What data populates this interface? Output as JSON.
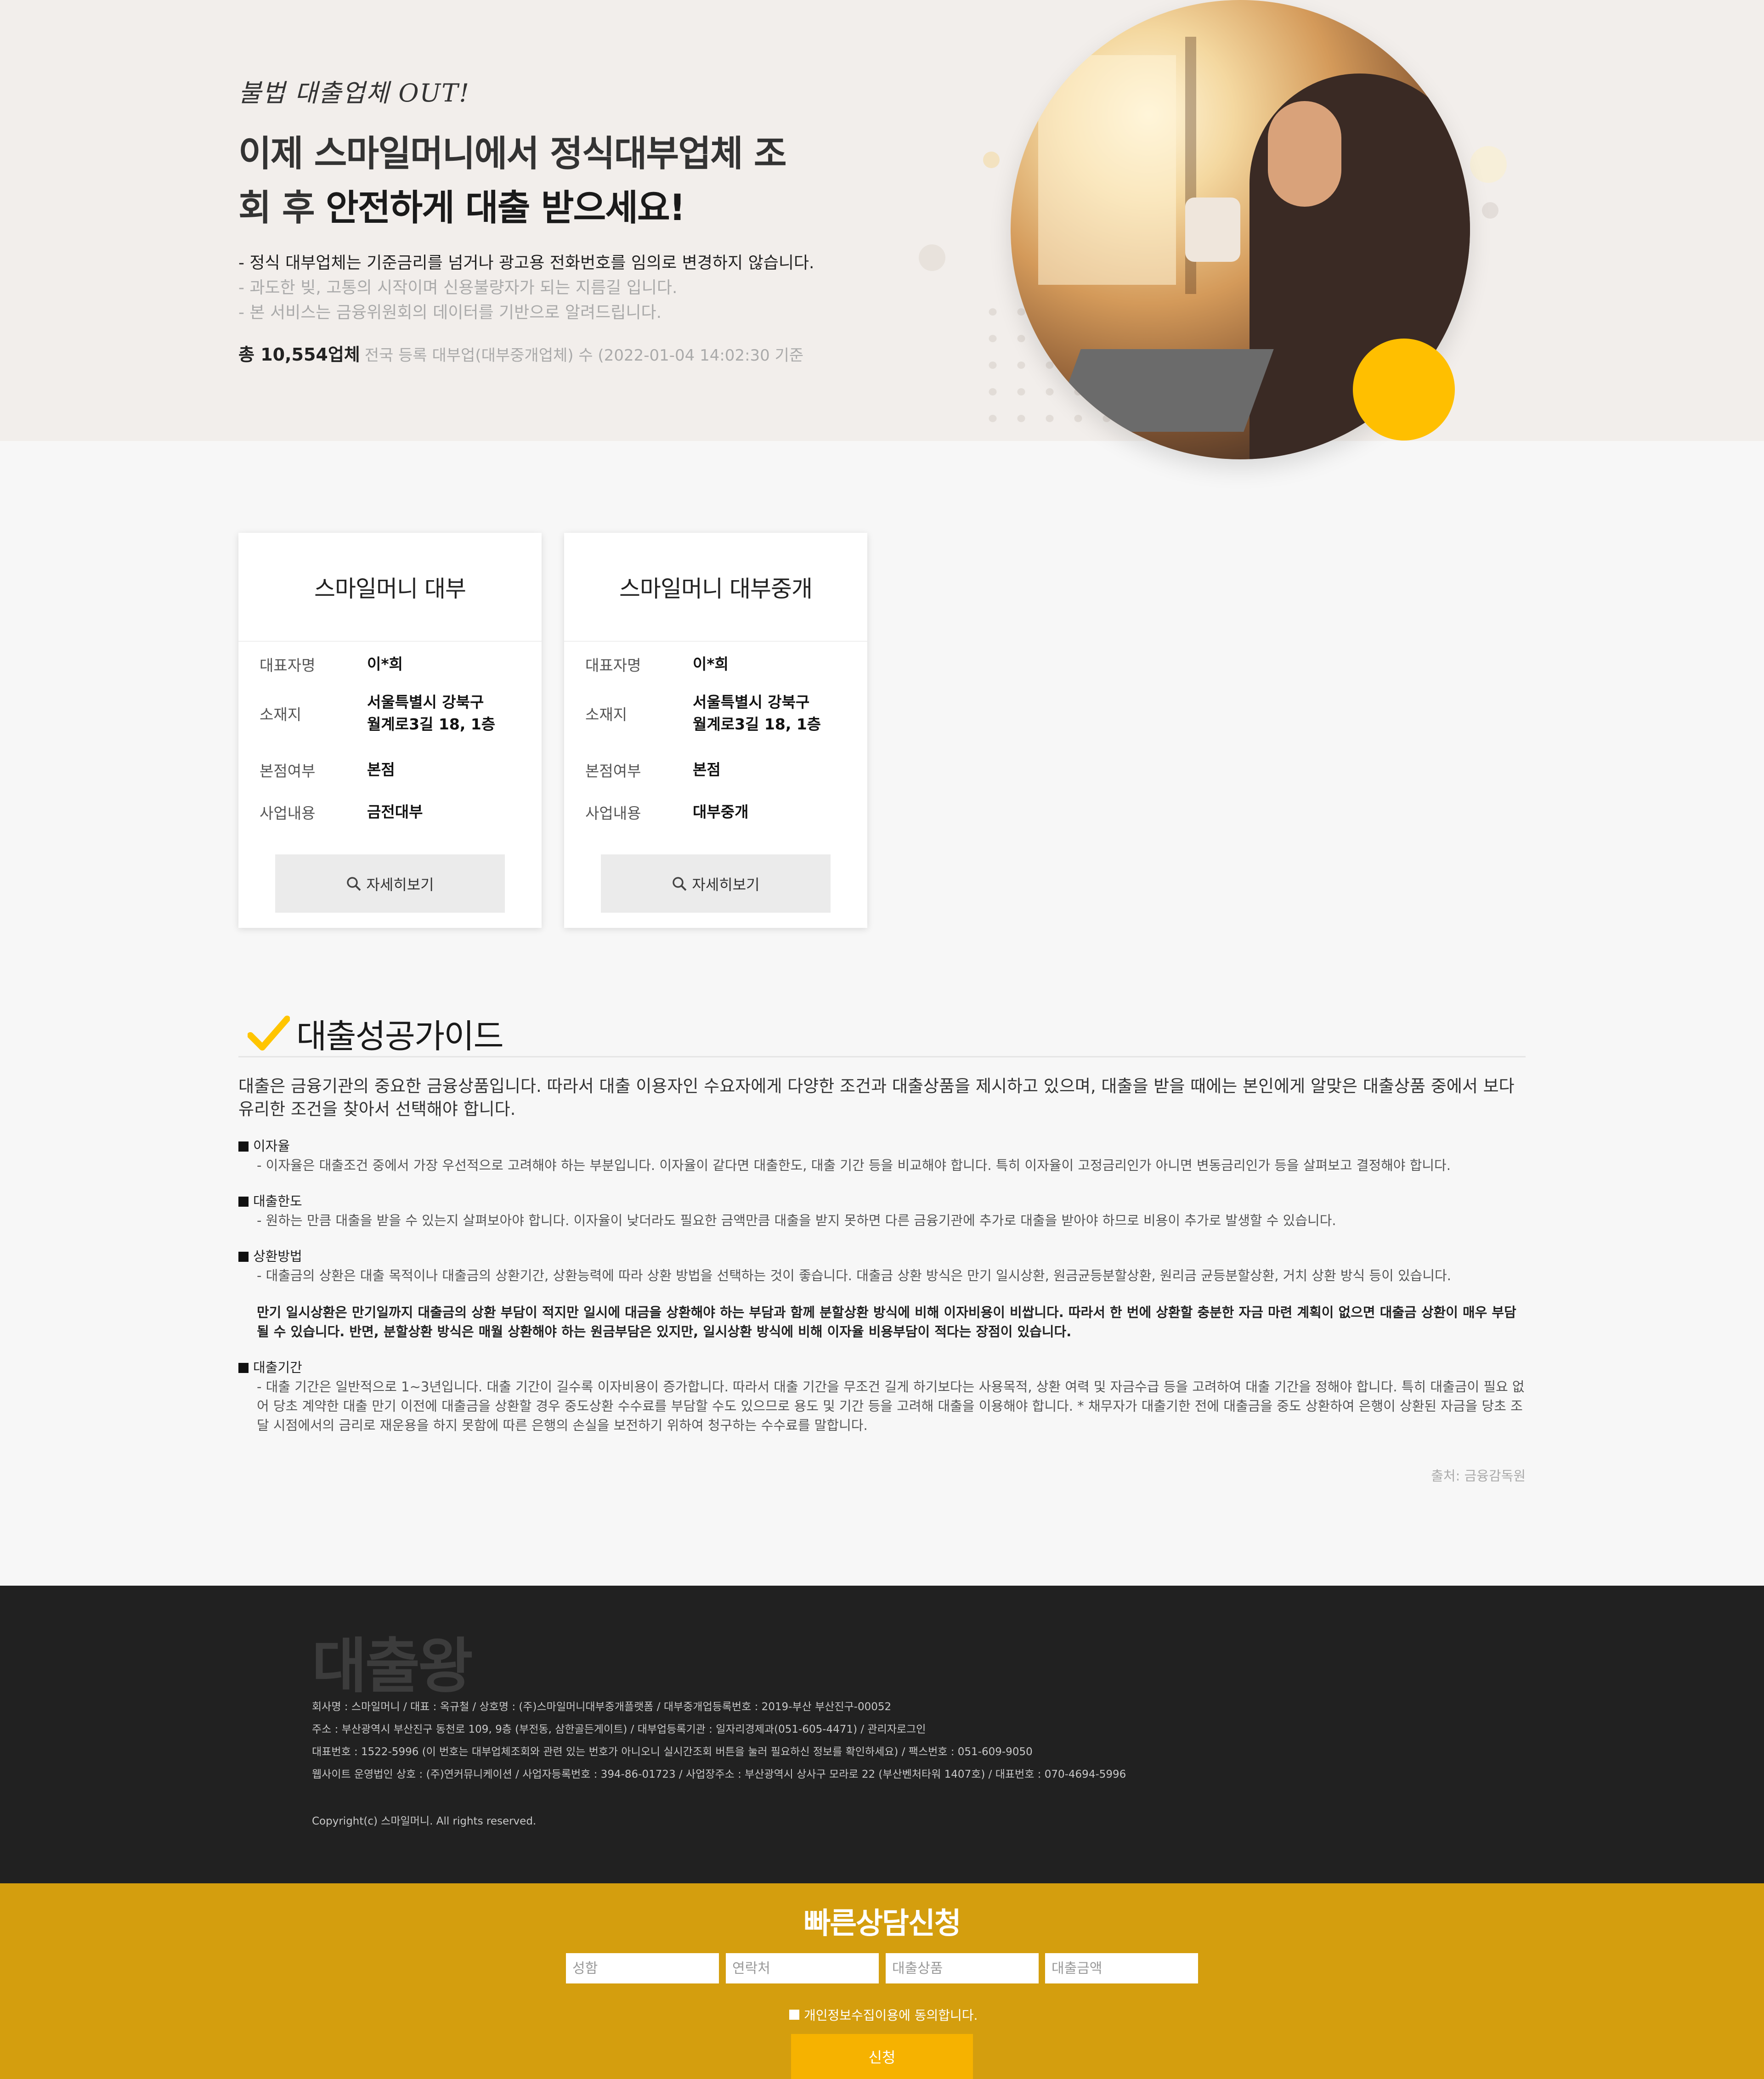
{
  "hero": {
    "tag": "불법 대출업체 OUT!",
    "title_line1": "이제 스마일머니에서 정식대부업체 조",
    "title_line2_prefix": "회 후 ",
    "title_line2_bold": "안전하게 대출 받으세요!",
    "bullet1": "- 정식 대부업체는 기준금리를 넘거나 광고용 전화번호를 임의로 변경하지 않습니다.",
    "bullet2": "- 과도한 빚, 고통의 시작이며 신용불량자가 되는 지름길 입니다.",
    "bullet3": "- 본 서비스는 금융위원회의 데이터를 기반으로 알려드립니다.",
    "count_bold": "총 10,554업체",
    "count_note": "전국 등록 대부업(대부중개업체) 수 (2022-01-04 14:02:30 기준"
  },
  "cards": [
    {
      "title": "스마일머니 대부",
      "rep_label": "대표자명",
      "rep": "이*희",
      "addr_label": "소재지",
      "addr1": "서울특별시 강북구",
      "addr2": "월계로3길 18, 1층",
      "branch_label": "본점여부",
      "branch": "본점",
      "biz_label": "사업내용",
      "biz": "금전대부",
      "button": "자세히보기"
    },
    {
      "title": "스마일머니 대부중개",
      "rep_label": "대표자명",
      "rep": "이*희",
      "addr_label": "소재지",
      "addr1": "서울특별시 강북구",
      "addr2": "월계로3길 18, 1층",
      "branch_label": "본점여부",
      "branch": "본점",
      "biz_label": "사업내용",
      "biz": "대부중개",
      "button": "자세히보기"
    }
  ],
  "guide": {
    "title": "대출성공가이드",
    "intro": "대출은 금융기관의 중요한 금융상품입니다. 따라서 대출 이용자인 수요자에게 다양한 조건과 대출상품을 제시하고 있으며, 대출을 받을 때에는 본인에게 알맞은 대출상품 중에서 보다 유리한 조건을 찾아서 선택해야 합니다.",
    "sections": [
      {
        "title": "이자율",
        "desc": "- 이자율은 대출조건 중에서 가장 우선적으로 고려해야 하는 부분입니다. 이자율이 같다면 대출한도, 대출 기간 등을 비교해야 합니다. 특히 이자율이 고정금리인가 아니면 변동금리인가 등을 살펴보고 결정해야 합니다."
      },
      {
        "title": "대출한도",
        "desc": "- 원하는 만큼 대출을 받을 수 있는지 살펴보아야 합니다. 이자율이 낮더라도 필요한 금액만큼 대출을 받지 못하면 다른 금융기관에 추가로 대출을 받아야 하므로 비용이 추가로 발생할 수 있습니다."
      },
      {
        "title": "상환방법",
        "desc": "- 대출금의 상환은 대출 목적이나 대출금의 상환기간, 상환능력에 따라 상환 방법을 선택하는 것이 좋습니다. 대출금 상환 방식은 만기 일시상환, 원금균등분할상환, 원리금 균등분할상환, 거치 상환 방식 등이 있습니다.",
        "bold": "만기 일시상환은 만기일까지 대출금의 상환 부담이 적지만 일시에 대금을 상환해야 하는 부담과 함께 분할상환 방식에 비해 이자비용이 비쌉니다. 따라서 한 번에 상환할 충분한 자금 마련 계획이 없으면 대출금 상환이 매우 부담 될 수 있습니다. 반면, 분할상환 방식은 매월 상환해야 하는 원금부담은 있지만, 일시상환 방식에 비해 이자율 비용부담이 적다는 장점이 있습니다."
      },
      {
        "title": "대출기간",
        "desc": "- 대출 기간은 일반적으로 1~3년입니다. 대출 기간이 길수록 이자비용이 증가합니다. 따라서 대출 기간을 무조건 길게 하기보다는 사용목적, 상환 여력 및 자금수급 등을 고려하여 대출 기간을 정해야 합니다. 특히 대출금이 필요 없어 당초 계약한 대출 만기 이전에 대출금을 상환할 경우 중도상환 수수료를 부담할 수도 있으므로 용도 및 기간 등을 고려해 대출을 이용해야 합니다. * 채무자가 대출기한 전에 대출금을 중도 상환하여 은행이 상환된 자금을 당초 조달 시점에서의 금리로 재운용을 하지 못함에 따른 은행의 손실을 보전하기 위하여 청구하는 수수료를 말합니다."
      }
    ],
    "source": "출처: 금융감독원"
  },
  "footer": {
    "logo": "대출왕",
    "line1": "회사명 : 스마일머니 / 대표 : 옥규철 / 상호명 : (주)스마일머니대부중개플랫폼 / 대부중개업등록번호 : 2019-부산 부산진구-00052",
    "line2": "주소 : 부산광역시 부산진구 동천로 109, 9층 (부전동, 삼한골든게이트) / 대부업등록기관 : 일자리경제과(051-605-4471) / 관리자로그인",
    "line3": "대표번호 : 1522-5996 (이 번호는 대부업체조회와 관련 있는 번호가 아니오니 실시간조회 버튼을 눌러 필요하신 정보를 확인하세요) / 팩스번호 : 051-609-9050",
    "line4": "웹사이트 운영법인 상호 : (주)연커뮤니케이션 / 사업자등록번호 : 394-86-01723 / 사업장주소 : 부산광역시 상사구 모라로 22 (부산벤처타워 1407호) / 대표번호 : 070-4694-5996",
    "copyright": "Copyright(c) 스마일머니. All rights reserved."
  },
  "consult": {
    "title": "빠른상담신청",
    "name_placeholder": "성함",
    "phone_placeholder": "연락처",
    "product_placeholder": "대출상품",
    "amount_placeholder": "대출금액",
    "agree": "개인정보수집이용에 동의합니다.",
    "submit": "신청"
  },
  "colors": {
    "accent": "#ffbf00",
    "consult_bg": "#d49e0e",
    "footer_bg": "#212121"
  }
}
